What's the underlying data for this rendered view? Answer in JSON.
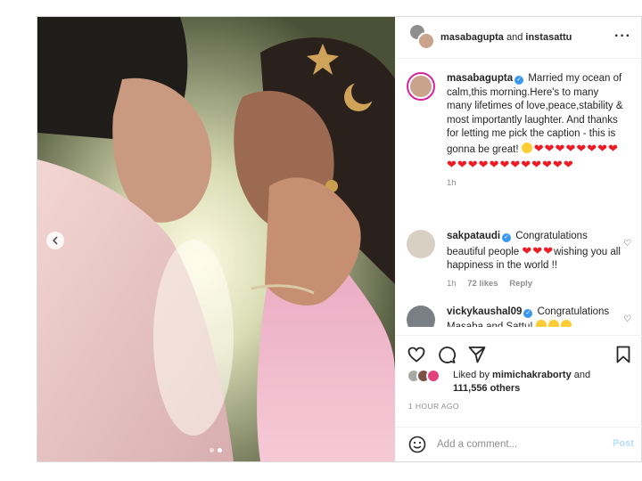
{
  "post": {
    "header": {
      "author": "masabagupta",
      "joiner": "and",
      "collaborator": "instasattu",
      "more_icon": "more-horizontal-icon"
    },
    "carousel": {
      "slide_count": 2,
      "active_slide": 2
    },
    "caption": {
      "user": "masabagupta",
      "text": "Married my ocean of calm,this morning.Here's to many many lifetimes of love,peace,stability & most importantly laughter. And thanks for letting me pick the caption - this is gonna be great! ",
      "emoji": "😄",
      "hearts": "❤❤❤❤❤❤❤❤❤❤❤❤❤❤❤❤❤❤❤❤",
      "time": "1h"
    },
    "comments": [
      {
        "user": "sakpataudi",
        "text_before": "Congratulations beautiful people ",
        "hearts": "❤❤❤",
        "text_after": "wishing you all happiness in the world !!",
        "time": "1h",
        "likes": "72 likes",
        "reply": "Reply"
      },
      {
        "user": "vickykaushal09",
        "text": "Congratulations Masaba and Sattu! ",
        "emoji": "🤗🤗🤗"
      }
    ],
    "likes": {
      "prefix": "Liked by",
      "first_user": "mimichakraborty",
      "joiner": "and",
      "others": "111,556 others"
    },
    "timestamp": "1 HOUR AGO",
    "add_comment": {
      "placeholder": "Add a comment...",
      "post_label": "Post"
    },
    "colors": {
      "verified": "#3897f0",
      "heart": "#ed1c24",
      "post_button": "#b2dffc",
      "story_ring": "#d6249f"
    }
  }
}
